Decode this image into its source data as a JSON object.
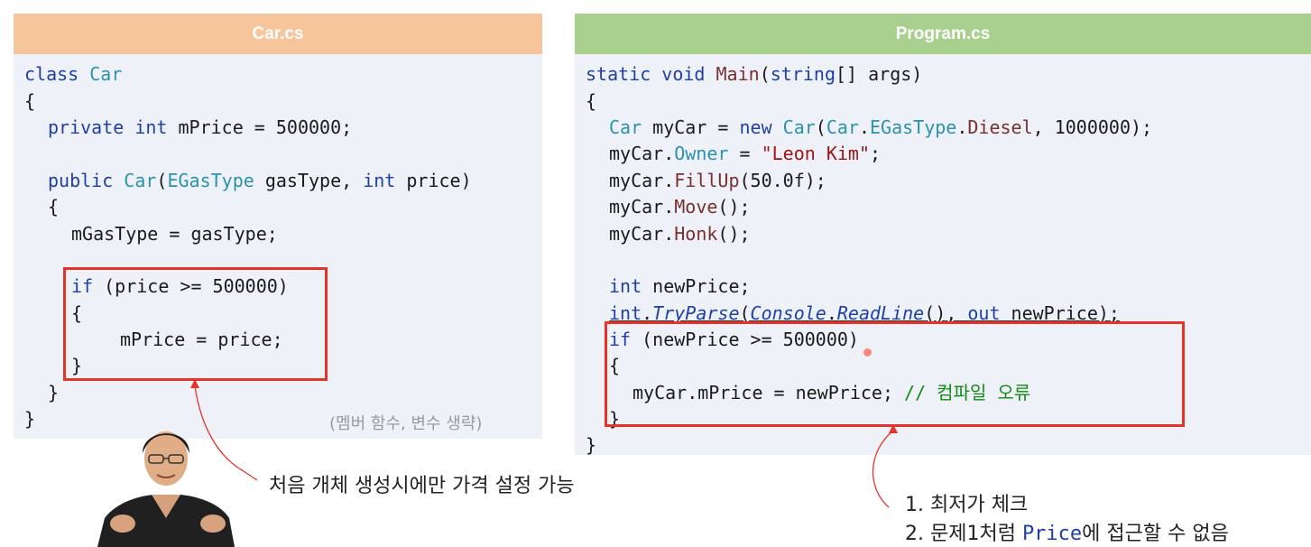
{
  "left_panel": {
    "title": "Car.cs",
    "lines": [
      "class Car",
      "{",
      "private int mPrice = 500000;",
      "public Car(EGasType gasType, int price)",
      "{",
      "mGasType = gasType;",
      "if (price >= 500000)",
      "{",
      "mPrice = price;",
      "}",
      "}",
      "}"
    ],
    "note": "(멤버 함수, 변수 생략)"
  },
  "right_panel": {
    "title": "Program.cs",
    "lines": [
      "static void Main(string[] args)",
      "{",
      "Car myCar = new Car(Car.EGasType.Diesel, 1000000);",
      "myCar.Owner = \"Leon Kim\";",
      "myCar.FillUp(50.0f);",
      "myCar.Move();",
      "myCar.Honk();",
      "int newPrice;",
      "int.TryParse(Console.ReadLine(), out newPrice);",
      "if (newPrice >= 500000)",
      "{",
      "myCar.mPrice = newPrice; // 컴파일 오류",
      "}",
      "}"
    ]
  },
  "captions": {
    "left": "처음 개체 생성시에만 가격 설정 가능",
    "right_1": "1.  최저가 체크",
    "right_2_pre": "2.  문제1처럼 ",
    "right_2_code": "Price",
    "right_2_post": "에 접근할 수 없음"
  },
  "colors": {
    "left_header": "#f7c59b",
    "right_header": "#a9d08e",
    "panel_bg": "#eef2f8",
    "highlight_box": "#e6332a",
    "keyword": "#1f3fa8",
    "type": "#2b91af",
    "string": "#a31515",
    "comment": "#138a13"
  },
  "icons": {
    "presenter": "presenter-photo"
  }
}
